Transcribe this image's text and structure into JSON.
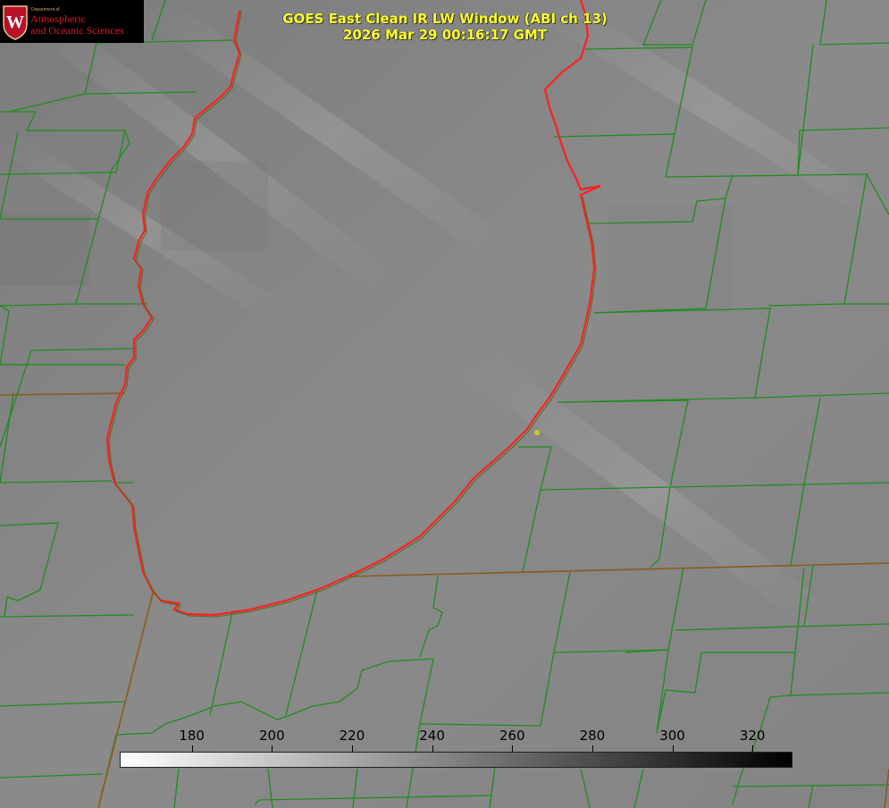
{
  "title": {
    "line1": "GOES East Clean IR LW Window (ABI ch 13)",
    "line2": "2026 Mar 29 00:16:17 GMT"
  },
  "logo": {
    "department": "Department of",
    "line1": "Atmospheric",
    "line2": "and Oceanic Sciences",
    "seal_letter": "W"
  },
  "colorbar": {
    "min": 162,
    "max": 330,
    "ticks": [
      "180",
      "200",
      "220",
      "240",
      "260",
      "280",
      "300",
      "320"
    ],
    "gradient_start": "#ffffff",
    "gradient_end": "#000000"
  },
  "colors": {
    "county_lines": "#1f8c1f",
    "coastline": "#ff2020",
    "state_lines": "#8a5a1c",
    "title_text": "#ffff2a",
    "marker": "#e0c020",
    "logo_red": "#d41c2c"
  }
}
